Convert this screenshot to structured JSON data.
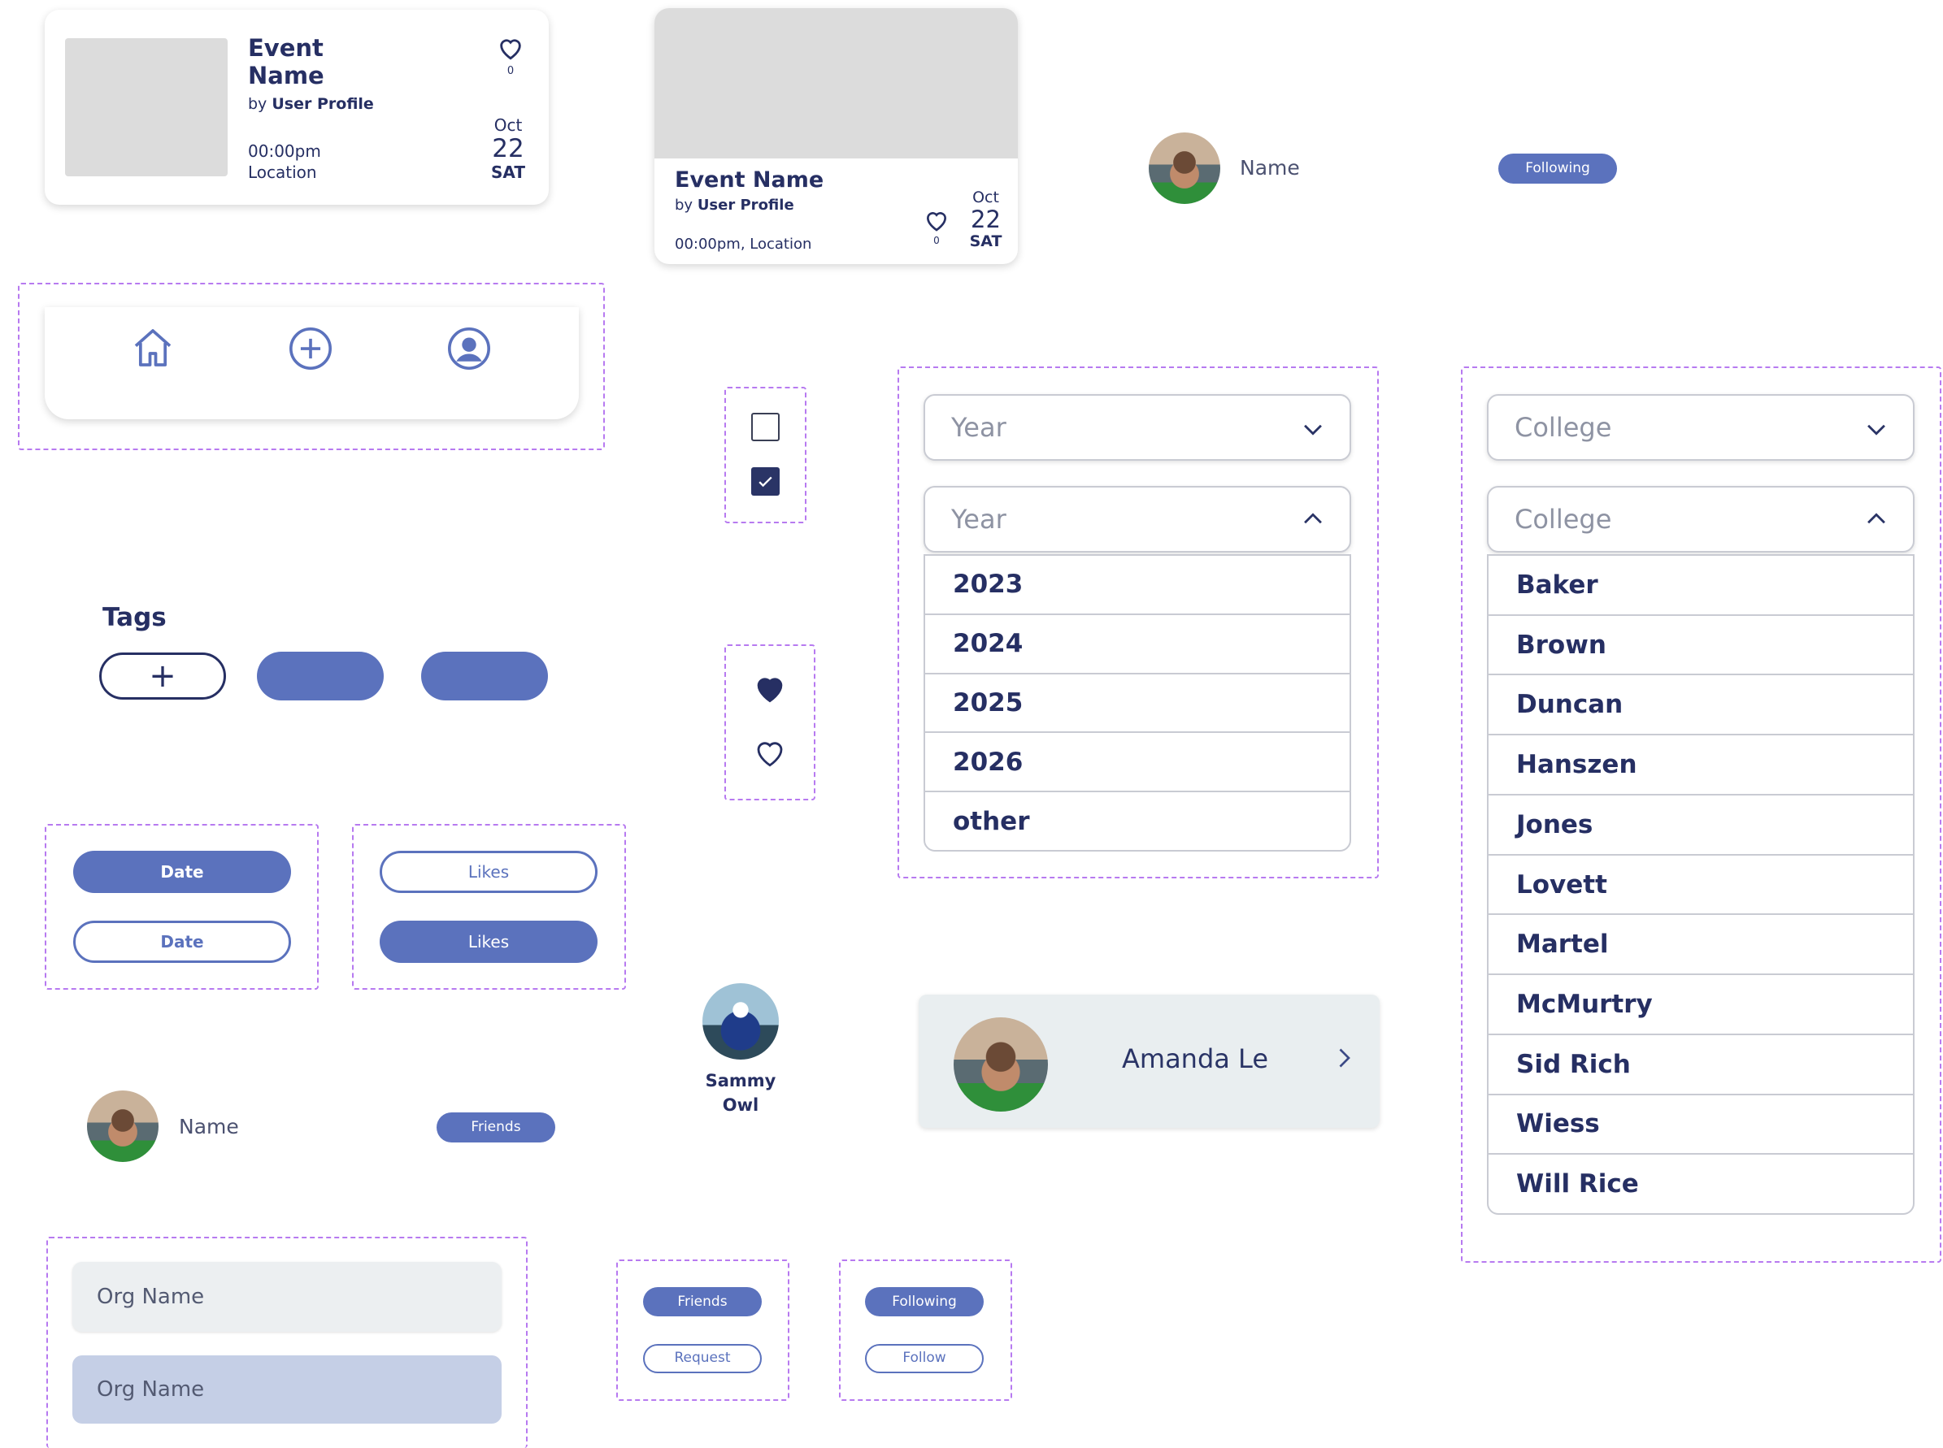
{
  "event_card_1": {
    "title": "Event\nName",
    "by_prefix": "by",
    "author": "User Profile",
    "time": "00:00pm",
    "location": "Location",
    "month": "Oct",
    "day": "22",
    "weekday": "SAT",
    "likes": "0"
  },
  "event_card_2": {
    "title": "Event Name",
    "by_prefix": "by",
    "author": "User Profile",
    "time_location": "00:00pm, Location",
    "month": "Oct",
    "day": "22",
    "weekday": "SAT",
    "likes": "0"
  },
  "following_row": {
    "name": "Name",
    "badge": "Following"
  },
  "friends_row": {
    "name": "Name",
    "badge": "Friends"
  },
  "nav_bar": {
    "icons": [
      "home-icon",
      "add-circle-icon",
      "profile-icon"
    ]
  },
  "checkboxes": {
    "unchecked": false,
    "checked": true
  },
  "tags": {
    "title": "Tags",
    "add_symbol": "+"
  },
  "sort_date": {
    "filled": "Date",
    "outline": "Date"
  },
  "sort_likes": {
    "outline": "Likes",
    "filled": "Likes"
  },
  "year_dropdown": {
    "placeholder": "Year",
    "options": [
      "2023",
      "2024",
      "2025",
      "2026",
      "other"
    ]
  },
  "college_dropdown": {
    "placeholder": "College",
    "options": [
      "Baker",
      "Brown",
      "Duncan",
      "Hanszen",
      "Jones",
      "Lovett",
      "Martel",
      "McMurtry",
      "Sid Rich",
      "Wiess",
      "Will Rice"
    ]
  },
  "mascot": {
    "name": "Sammy\nOwl"
  },
  "profile_card": {
    "name": "Amanda Le"
  },
  "org_inputs": {
    "default": "Org Name",
    "selected": "Org Name"
  },
  "friend_buttons": {
    "filled": "Friends",
    "outline": "Request"
  },
  "follow_buttons": {
    "filled": "Following",
    "outline": "Follow"
  },
  "colors": {
    "navy": "#262f63",
    "accent": "#5b72bd",
    "dashed_outline": "#b77af0",
    "input_gray": "#eceff1",
    "input_selected": "#c5cfe6"
  }
}
